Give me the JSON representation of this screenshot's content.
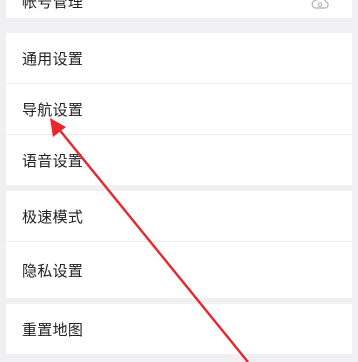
{
  "settings": {
    "account": {
      "label": "帐号管理"
    },
    "items": [
      {
        "label": "通用设置"
      },
      {
        "label": "导航设置"
      },
      {
        "label": "语音设置"
      },
      {
        "label": "极速模式"
      },
      {
        "label": "隐私设置"
      },
      {
        "label": "重置地图"
      }
    ],
    "icons": {
      "account": "cloud-user-icon"
    }
  },
  "annotation": {
    "color": "#e8262b",
    "target": "导航设置"
  }
}
